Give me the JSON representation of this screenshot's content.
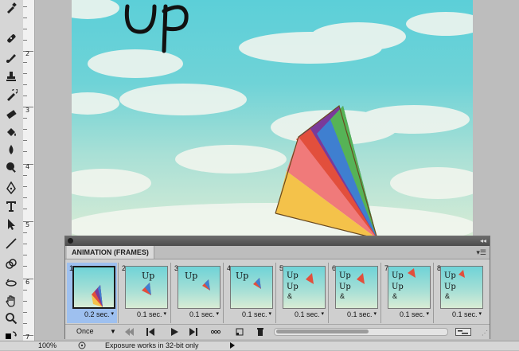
{
  "document": {
    "title_text": "Up",
    "ruler_numbers": [
      "2",
      "3",
      "4",
      "5",
      "6",
      "7"
    ]
  },
  "tools": [
    {
      "icon": "eyedropper-icon"
    },
    {
      "icon": "healing-brush-icon"
    },
    {
      "icon": "brush-icon"
    },
    {
      "icon": "clone-stamp-icon"
    },
    {
      "icon": "history-brush-icon"
    },
    {
      "icon": "eraser-icon"
    },
    {
      "icon": "paint-bucket-icon"
    },
    {
      "icon": "blur-icon"
    },
    {
      "icon": "dodge-icon"
    },
    {
      "icon": "pen-icon"
    },
    {
      "icon": "type-icon"
    },
    {
      "icon": "path-selection-icon"
    },
    {
      "icon": "line-icon"
    },
    {
      "icon": "3d-rotate-icon"
    },
    {
      "icon": "3d-orbit-icon"
    },
    {
      "icon": "hand-icon"
    },
    {
      "icon": "zoom-icon"
    },
    {
      "icon": "swap-colors-icon"
    }
  ],
  "animation_panel": {
    "title": "ANIMATION (FRAMES)",
    "frames": [
      {
        "number": "1",
        "delay": "0.2 sec.",
        "selected": true
      },
      {
        "number": "2",
        "delay": "0.1 sec.",
        "selected": false
      },
      {
        "number": "3",
        "delay": "0.1 sec.",
        "selected": false
      },
      {
        "number": "4",
        "delay": "0.1 sec.",
        "selected": false
      },
      {
        "number": "5",
        "delay": "0.1 sec.",
        "selected": false
      },
      {
        "number": "6",
        "delay": "0.1 sec.",
        "selected": false
      },
      {
        "number": "7",
        "delay": "0.1 sec.",
        "selected": false
      },
      {
        "number": "8",
        "delay": "0.1 sec.",
        "selected": false
      }
    ],
    "loop_option": "Once",
    "scroll_fraction": 0.55
  },
  "status_bar": {
    "zoom": "100%",
    "message": "Exposure works in 32-bit only"
  },
  "colors": {
    "selected_frame": "#9ec0ef",
    "panel_bg": "#cfcfcf",
    "sky": "#6fd3d7"
  }
}
